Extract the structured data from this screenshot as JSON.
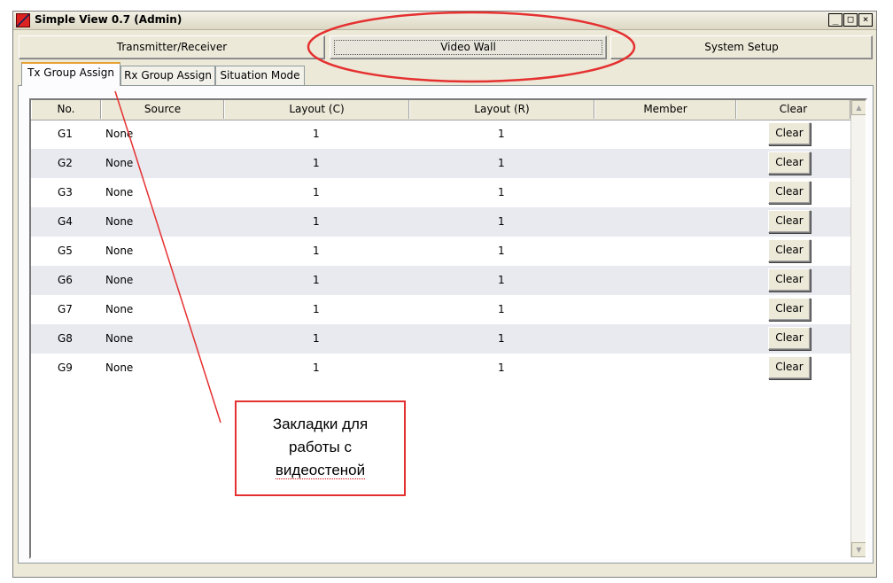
{
  "window": {
    "title": "Simple View 0.7 (Admin)",
    "controls": {
      "minimize": "_",
      "maximize": "□",
      "close": "×"
    }
  },
  "nav": {
    "buttons": [
      {
        "label": "Transmitter/Receiver"
      },
      {
        "label": "Video Wall",
        "active": true
      },
      {
        "label": "System Setup"
      }
    ]
  },
  "tabs": [
    {
      "label": "Tx Group Assign",
      "active": true
    },
    {
      "label": "Rx Group Assign"
    },
    {
      "label": "Situation Mode"
    }
  ],
  "table": {
    "columns": [
      "No.",
      "Source",
      "Layout (C)",
      "Layout (R)",
      "Member",
      "Clear"
    ],
    "rows": [
      {
        "no": "G1",
        "source": "None",
        "layout_c": "1",
        "layout_r": "1",
        "member": "",
        "clear": "Clear"
      },
      {
        "no": "G2",
        "source": "None",
        "layout_c": "1",
        "layout_r": "1",
        "member": "",
        "clear": "Clear"
      },
      {
        "no": "G3",
        "source": "None",
        "layout_c": "1",
        "layout_r": "1",
        "member": "",
        "clear": "Clear"
      },
      {
        "no": "G4",
        "source": "None",
        "layout_c": "1",
        "layout_r": "1",
        "member": "",
        "clear": "Clear"
      },
      {
        "no": "G5",
        "source": "None",
        "layout_c": "1",
        "layout_r": "1",
        "member": "",
        "clear": "Clear"
      },
      {
        "no": "G6",
        "source": "None",
        "layout_c": "1",
        "layout_r": "1",
        "member": "",
        "clear": "Clear"
      },
      {
        "no": "G7",
        "source": "None",
        "layout_c": "1",
        "layout_r": "1",
        "member": "",
        "clear": "Clear"
      },
      {
        "no": "G8",
        "source": "None",
        "layout_c": "1",
        "layout_r": "1",
        "member": "",
        "clear": "Clear"
      },
      {
        "no": "G9",
        "source": "None",
        "layout_c": "1",
        "layout_r": "1",
        "member": "",
        "clear": "Clear"
      }
    ]
  },
  "scrollbar": {
    "up_icon": "scroll-up-arrow-icon",
    "down_icon": "scroll-down-arrow-icon"
  },
  "annotation": {
    "line1": "Закладки для",
    "line2": "работы с",
    "line3": "видеостеной",
    "color": "#e53030"
  }
}
